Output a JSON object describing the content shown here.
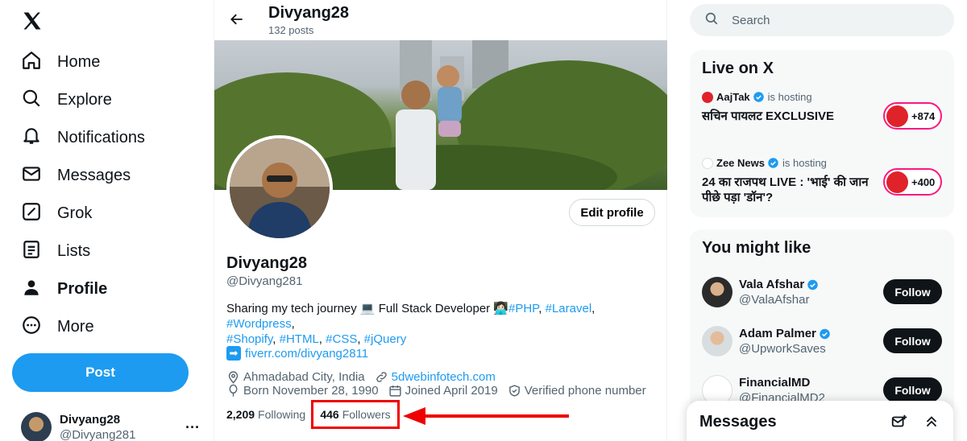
{
  "nav": {
    "items": [
      {
        "label": "Home",
        "icon": "home-icon"
      },
      {
        "label": "Explore",
        "icon": "search-icon"
      },
      {
        "label": "Notifications",
        "icon": "bell-icon"
      },
      {
        "label": "Messages",
        "icon": "envelope-icon"
      },
      {
        "label": "Grok",
        "icon": "grok-icon"
      },
      {
        "label": "Lists",
        "icon": "list-icon"
      },
      {
        "label": "Profile",
        "icon": "person-icon"
      },
      {
        "label": "More",
        "icon": "more-circle-icon"
      }
    ],
    "post_label": "Post",
    "account": {
      "name": "Divyang28",
      "handle": "@Divyang281",
      "more": "···"
    }
  },
  "header": {
    "title": "Divyang28",
    "subtitle": "132 posts"
  },
  "profile": {
    "edit_label": "Edit profile",
    "name": "Divyang28",
    "handle": "@Divyang281",
    "bio_line1_text": "Sharing my tech journey 💻 Full Stack Developer 👩🏻‍💻",
    "bio_tags_line1": [
      "#PHP",
      "#Laravel",
      "#Wordpress"
    ],
    "bio_tags_line2": [
      "#Shopify",
      "#HTML",
      "#CSS",
      "#jQuery"
    ],
    "website": "fiverr.com/divyang2811",
    "location": "Ahmadabad City, India",
    "link": "5dwebinfotech.com",
    "born": "Born November 28, 1990",
    "joined": "Joined April 2019",
    "verified_phone": "Verified phone number",
    "following_count": "2,209",
    "following_label": "Following",
    "followers_count": "446",
    "followers_label": "Followers"
  },
  "search": {
    "placeholder": "Search"
  },
  "live": {
    "title": "Live on X",
    "items": [
      {
        "host": "AajTak",
        "hosting": "is hosting",
        "title": "सचिन पायलट EXCLUSIVE",
        "count": "+874"
      },
      {
        "host": "Zee News",
        "hosting": "is hosting",
        "title": "24 का राजपथ LIVE : 'भाई' की जान पीछे पड़ा 'डॉन'?",
        "count": "+400"
      }
    ]
  },
  "who": {
    "title": "You might like",
    "items": [
      {
        "name": "Vala Afshar",
        "handle": "@ValaAfshar",
        "verified": true,
        "button": "Follow"
      },
      {
        "name": "Adam Palmer",
        "handle": "@UpworkSaves",
        "verified": true,
        "button": "Follow"
      },
      {
        "name": "FinancialMD",
        "handle": "@FinancialMD2",
        "verified": false,
        "button": "Follow"
      }
    ]
  },
  "messages_dock": {
    "title": "Messages"
  },
  "colors": {
    "accent": "#1d9bf0",
    "highlight": "#e00000",
    "live": "#f91880"
  }
}
